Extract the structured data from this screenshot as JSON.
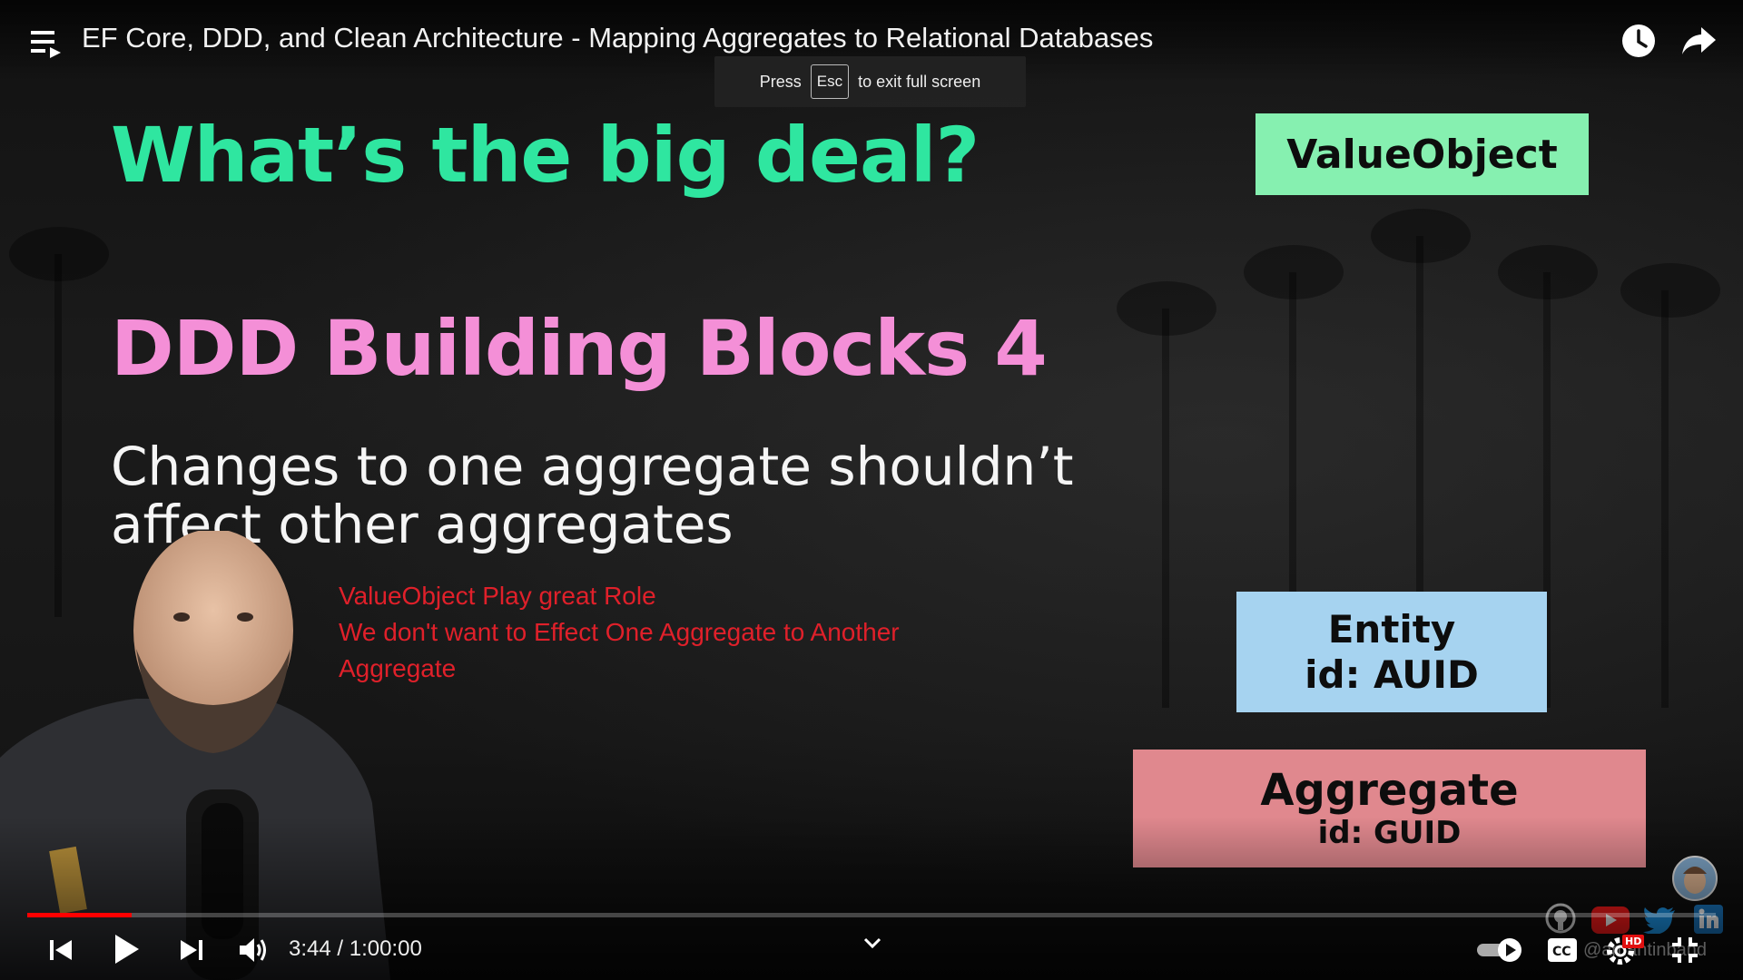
{
  "player": {
    "title": "EF Core, DDD, and Clean Architecture - Mapping Aggregates to Relational Databases",
    "toast": {
      "press": "Press",
      "key": "Esc",
      "suffix": "to exit full screen"
    },
    "time": "3:44 / 1:00:00",
    "progress_fraction": 0.062,
    "accent": "#ff0000",
    "watermark": "@amantinband",
    "icons": [
      "playlist-icon",
      "watch-later-icon",
      "share-icon",
      "previous-icon",
      "play-icon",
      "next-icon",
      "volume-icon",
      "chevron-down-icon",
      "autoplay-toggle",
      "cc-icon",
      "settings-icon",
      "exit-fullscreen-icon"
    ],
    "hd_badge": "HD"
  },
  "slide": {
    "heading": "What’s the big deal?",
    "subheading": "DDD Building Blocks  4",
    "body_line1": "Changes to one aggregate shouldn’t",
    "body_line2": "affect other aggregates",
    "annotation": [
      "ValueObject Play great Role",
      "We don't want to Effect One Aggregate to Another",
      "Aggregate"
    ],
    "boxes": {
      "valueobject": "ValueObject",
      "entity_title": "Entity",
      "entity_id": "id: AUID",
      "aggregate_title": "Aggregate",
      "aggregate_id": "id: GUID"
    },
    "colors": {
      "heading": "#2fe6a0",
      "subheading": "#f48fd7",
      "annotation": "#e0202a",
      "valueobject_box": "#86f0b0",
      "entity_box": "#a6d3f0",
      "aggregate_box": "#e0888e"
    }
  },
  "socials": [
    "github-icon",
    "youtube-icon",
    "twitter-icon",
    "linkedin-icon"
  ]
}
